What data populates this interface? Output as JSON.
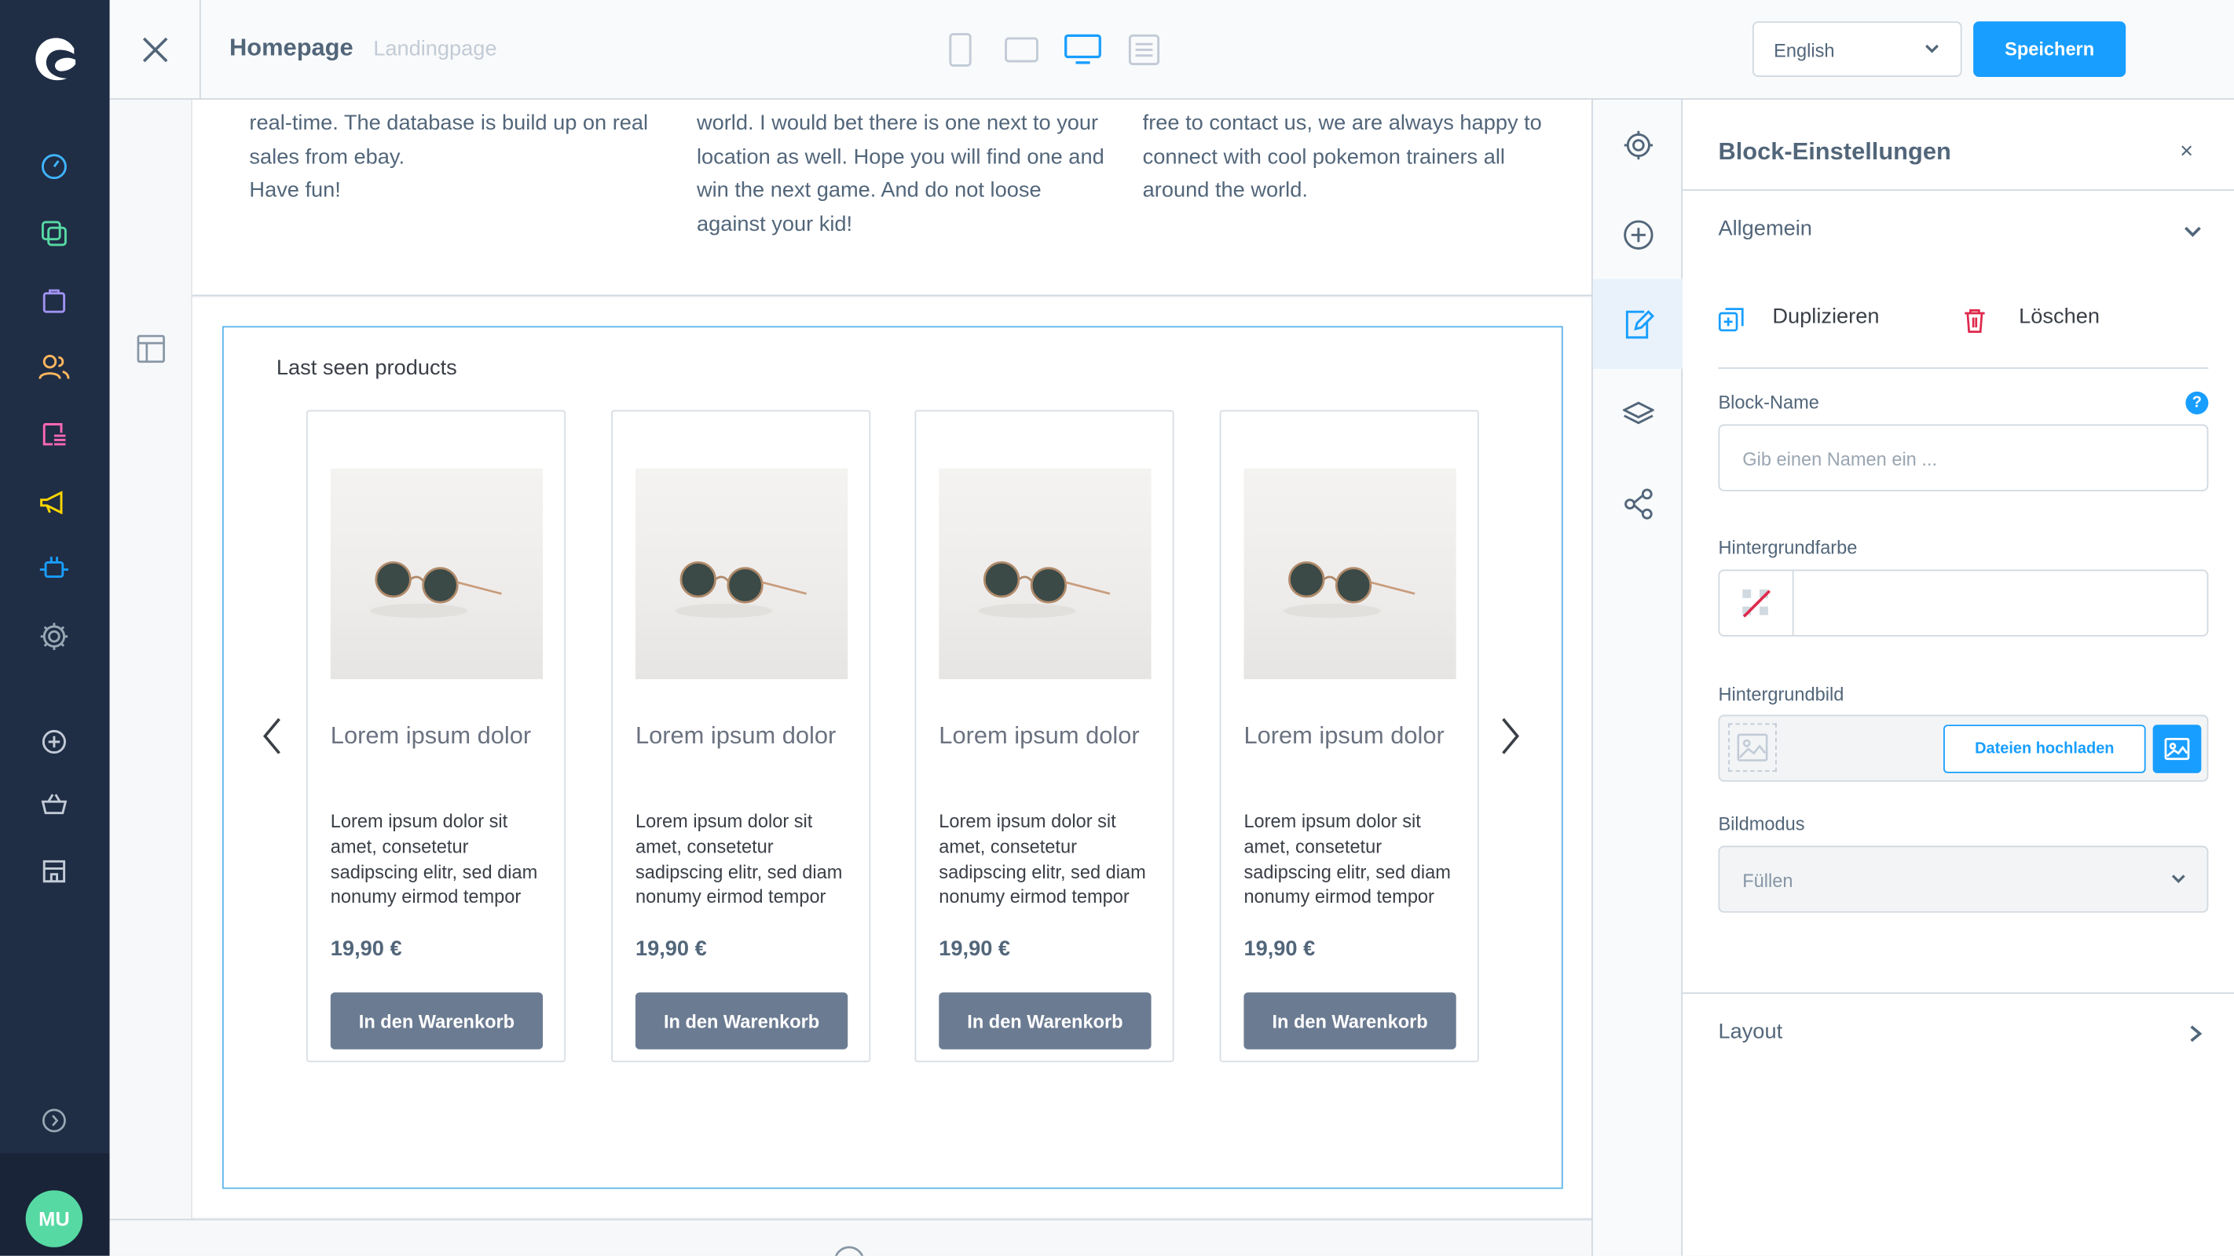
{
  "topbar": {
    "title": "Homepage",
    "subtitle": "Landingpage",
    "language": "English",
    "save_label": "Speichern"
  },
  "sidebar": {
    "avatar_initials": "MU",
    "items": [
      "dashboard-icon",
      "catalogue-icon",
      "orders-icon",
      "customers-icon",
      "content-icon",
      "marketing-icon",
      "extensions-icon",
      "settings-icon",
      "add-icon",
      "basket-icon",
      "store-icon",
      "expand-icon"
    ]
  },
  "text_columns": [
    {
      "text": "real-time. The database is build up on real sales from ebay.\nHave fun!"
    },
    {
      "text": "world. I would bet there is one next to your location as well. Hope you will find one and win the next game. And do not loose against your kid!"
    },
    {
      "text": "free to contact us, we are always happy to connect with cool pokemon trainers all around the world."
    }
  ],
  "slider": {
    "title": "Last seen products",
    "products": [
      {
        "name": "Lorem ipsum dolor",
        "description": "Lorem ipsum dolor sit amet, consetetur sadipscing elitr, sed diam nonumy eirmod tempor",
        "price": "19,90 €",
        "button": "In den Warenkorb"
      },
      {
        "name": "Lorem ipsum dolor",
        "description": "Lorem ipsum dolor sit amet, consetetur sadipscing elitr, sed diam nonumy eirmod tempor",
        "price": "19,90 €",
        "button": "In den Warenkorb"
      },
      {
        "name": "Lorem ipsum dolor",
        "description": "Lorem ipsum dolor sit amet, consetetur sadipscing elitr, sed diam nonumy eirmod tempor",
        "price": "19,90 €",
        "button": "In den Warenkorb"
      },
      {
        "name": "Lorem ipsum dolor",
        "description": "Lorem ipsum dolor sit amet, consetetur sadipscing elitr, sed diam nonumy eirmod tempor",
        "price": "19,90 €",
        "button": "In den Warenkorb"
      }
    ]
  },
  "panel": {
    "title": "Block-Einstellungen",
    "close": "×",
    "general_label": "Allgemein",
    "duplicate_label": "Duplizieren",
    "delete_label": "Löschen",
    "block_name_label": "Block-Name",
    "block_name_placeholder": "Gib einen Namen ein ...",
    "help": "?",
    "bg_color_label": "Hintergrundfarbe",
    "bg_image_label": "Hintergrundbild",
    "upload_label": "Dateien hochladen",
    "image_mode_label": "Bildmodus",
    "image_mode_value": "Füllen",
    "layout_label": "Layout"
  },
  "colors": {
    "accent": "#189eff",
    "sidebar": "#1f2d45",
    "avatar": "#57d9a3",
    "cart_button": "#6b7b92"
  }
}
